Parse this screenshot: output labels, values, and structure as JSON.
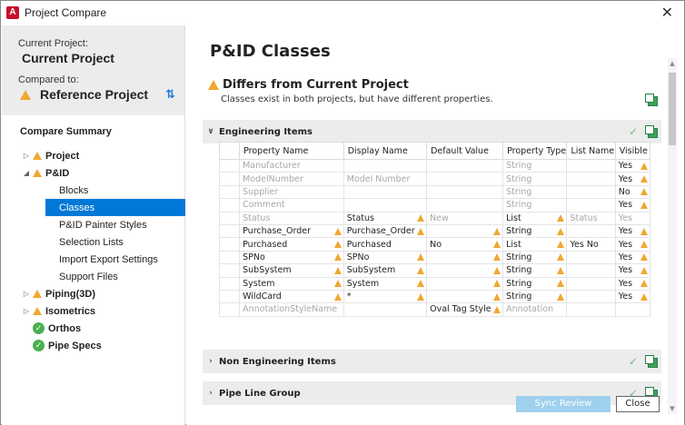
{
  "window": {
    "title": "Project Compare",
    "logo_letter": "A",
    "close_glyph": "✕"
  },
  "left": {
    "current_label": "Current Project:",
    "current_name": "Current Project",
    "compared_label": "Compared to:",
    "reference_name": "Reference Project",
    "summary_title": "Compare Summary",
    "tree": {
      "project": "Project",
      "pid": "P&ID",
      "blocks": "Blocks",
      "classes": "Classes",
      "painter": "P&ID Painter Styles",
      "selection": "Selection Lists",
      "import_export": "Import Export Settings",
      "support": "Support Files",
      "piping": "Piping(3D)",
      "isometrics": "Isometrics",
      "orthos": "Orthos",
      "pipe_specs": "Pipe Specs"
    }
  },
  "main": {
    "title": "P&ID Classes",
    "differs_title": "Differs from Current Project",
    "differs_sub": "Classes exist in both projects, but have different properties.",
    "sections": {
      "engineering": "Engineering Items",
      "non_engineering": "Non Engineering Items",
      "pipe_line": "Pipe Line Group"
    },
    "columns": [
      "Property Name",
      "Display Name",
      "Default Value",
      "Property Type",
      "List Name",
      "Visible"
    ],
    "rows": [
      [
        "Manufacturer",
        "",
        "",
        "String",
        "",
        "Yes"
      ],
      [
        "ModelNumber",
        "Model Number",
        "",
        "String",
        "",
        "Yes"
      ],
      [
        "Supplier",
        "",
        "",
        "String",
        "",
        "No"
      ],
      [
        "Comment",
        "",
        "",
        "String",
        "",
        "Yes"
      ],
      [
        "Status",
        "Status",
        "New",
        "List",
        "Status",
        "Yes"
      ],
      [
        "Purchase_Order",
        "Purchase_Order",
        "",
        "String",
        "",
        "Yes"
      ],
      [
        "Purchased",
        "Purchased",
        "No",
        "List",
        "Yes  No",
        "Yes"
      ],
      [
        "SPNo",
        "SPNo",
        "",
        "String",
        "",
        "Yes"
      ],
      [
        "SubSystem",
        "SubSystem",
        "",
        "String",
        "",
        "Yes"
      ],
      [
        "System",
        "System",
        "",
        "String",
        "",
        "Yes"
      ],
      [
        "WildCard",
        "*",
        "",
        "String",
        "",
        "Yes"
      ],
      [
        "AnnotationStyleName",
        "",
        "Oval Tag Style",
        "Annotation",
        "",
        ""
      ]
    ]
  },
  "buttons": {
    "sync": "Sync Review",
    "close": "Close"
  },
  "colors": {
    "accent": "#0078d7",
    "warning": "#f0a830",
    "ok": "#4caf50",
    "sync_btn": "#9fd0ee"
  }
}
